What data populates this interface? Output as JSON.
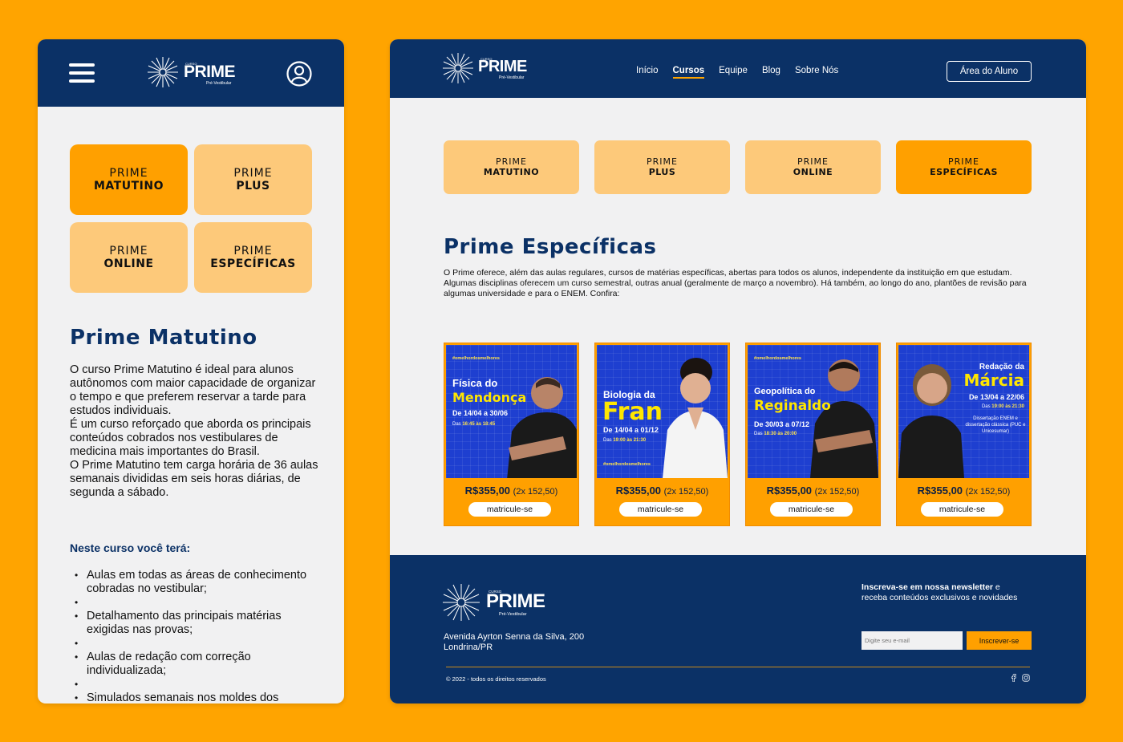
{
  "colors": {
    "background": "#FFA400",
    "navy": "#0B3166",
    "orange": "#FFA000",
    "light_orange": "#FDC97A"
  },
  "mobile": {
    "menu_icon": "hamburger-icon",
    "user_icon": "user-circle-icon",
    "logo": {
      "small": "CURSO",
      "name": "PRIME",
      "tag": "Pré-Vestibular"
    },
    "tabs": [
      {
        "top": "PRIME",
        "bottom": "MATUTINO",
        "active": true
      },
      {
        "top": "PRIME",
        "bottom": "PLUS",
        "active": false
      },
      {
        "top": "PRIME",
        "bottom": "ONLINE",
        "active": false
      },
      {
        "top": "PRIME",
        "bottom": "ESPECÍFICAS",
        "active": false
      }
    ],
    "title": "Prime Matutino",
    "description": [
      "O curso Prime Matutino é ideal para alunos autônomos com maior capacidade de organizar o tempo e que preferem reservar a tarde para estudos individuais.",
      "É um curso reforçado que aborda os principais conteúdos cobrados nos vestibulares de medicina mais importantes do Brasil.",
      "O Prime Matutino tem carga horária de 36 aulas semanais divididas em seis horas diárias, de segunda a sábado."
    ],
    "subtitle": "Neste curso você terá:",
    "list": [
      "Aulas em todas as áreas de conhecimento cobradas no vestibular;",
      "Detalhamento das principais matérias exigidas nas provas;",
      " Aulas de redação com correção individualizada;",
      "Simulados semanais nos moldes dos"
    ]
  },
  "desktop": {
    "logo": {
      "small": "CURSO",
      "name": "PRIME",
      "tag": "Pré-Vestibular"
    },
    "nav": [
      {
        "label": "Início",
        "active": false
      },
      {
        "label": "Cursos",
        "active": true
      },
      {
        "label": "Equipe",
        "active": false
      },
      {
        "label": "Blog",
        "active": false
      },
      {
        "label": "Sobre Nós",
        "active": false
      }
    ],
    "student_area": "Área do Aluno",
    "tabs": [
      {
        "top": "PRIME",
        "bottom": "MATUTINO",
        "active": false
      },
      {
        "top": "PRIME",
        "bottom": "PLUS",
        "active": false
      },
      {
        "top": "PRIME",
        "bottom": "ONLINE",
        "active": false
      },
      {
        "top": "PRIME",
        "bottom": "ESPECÍFICAS",
        "active": true
      }
    ],
    "title": "Prime Específicas",
    "description": "O Prime oferece, além das aulas regulares, cursos de matérias específicas, abertas para todos os alunos, independente da instituição em que estudam. Algumas disciplinas oferecem um curso semestral, outras anual (geralmente de março a novembro). Há também, ao longo do ano, plantões de revisão para algumas universidade e para o ENEM. Confira:",
    "cards": [
      {
        "tag": "#omelhordosmelhores",
        "line1": "Física do",
        "name": "Mendonça",
        "date": "De 14/04 a 30/06",
        "hours_prefix": "Das ",
        "hours": "16:45 às 18:45",
        "price": "R$355,00",
        "installments": "(2x 152,50)",
        "button": "matricule-se"
      },
      {
        "tag": "#omelhordosmelhores",
        "line1": "Biologia da",
        "name": "Fran",
        "date": "De 14/04 a 01/12",
        "hours_prefix": "Das ",
        "hours": "19:00 às 21:30",
        "price": "R$355,00",
        "installments": "(2x 152,50)",
        "button": "matricule-se"
      },
      {
        "tag": "#omelhordosmelhores",
        "line1": "Geopolítica do",
        "name": "Reginaldo",
        "date": "De 30/03 a 07/12",
        "hours_prefix": "Das ",
        "hours": "18:30 às 20:00",
        "price": "R$355,00",
        "installments": "(2x 152,50)",
        "button": "matricule-se"
      },
      {
        "tag": "",
        "line1": "Redação da",
        "name": "Márcia",
        "date": "De 13/04 a 22/06",
        "hours_prefix": "Das ",
        "hours": "19:00 às 21:30",
        "extra": "Dissertação ENEM e dissertação clássica (PUC e Unicesumar)",
        "price": "R$355,00",
        "installments": "(2x 152,50)",
        "button": "matricule-se"
      }
    ],
    "footer": {
      "address_line1": "Avenida Ayrton Senna da Silva, 200",
      "address_line2": "Londrina/PR",
      "newsletter_bold": "Inscreva-se em nossa newsletter",
      "newsletter_rest": " e receba conteúdos exclusivos e novidades",
      "email_placeholder": "Digite seu e-mail",
      "subscribe": "Inscrever-se",
      "copyright": "© 2022 - todos os direitos reservados",
      "social": [
        "facebook-icon",
        "instagram-icon"
      ]
    }
  }
}
